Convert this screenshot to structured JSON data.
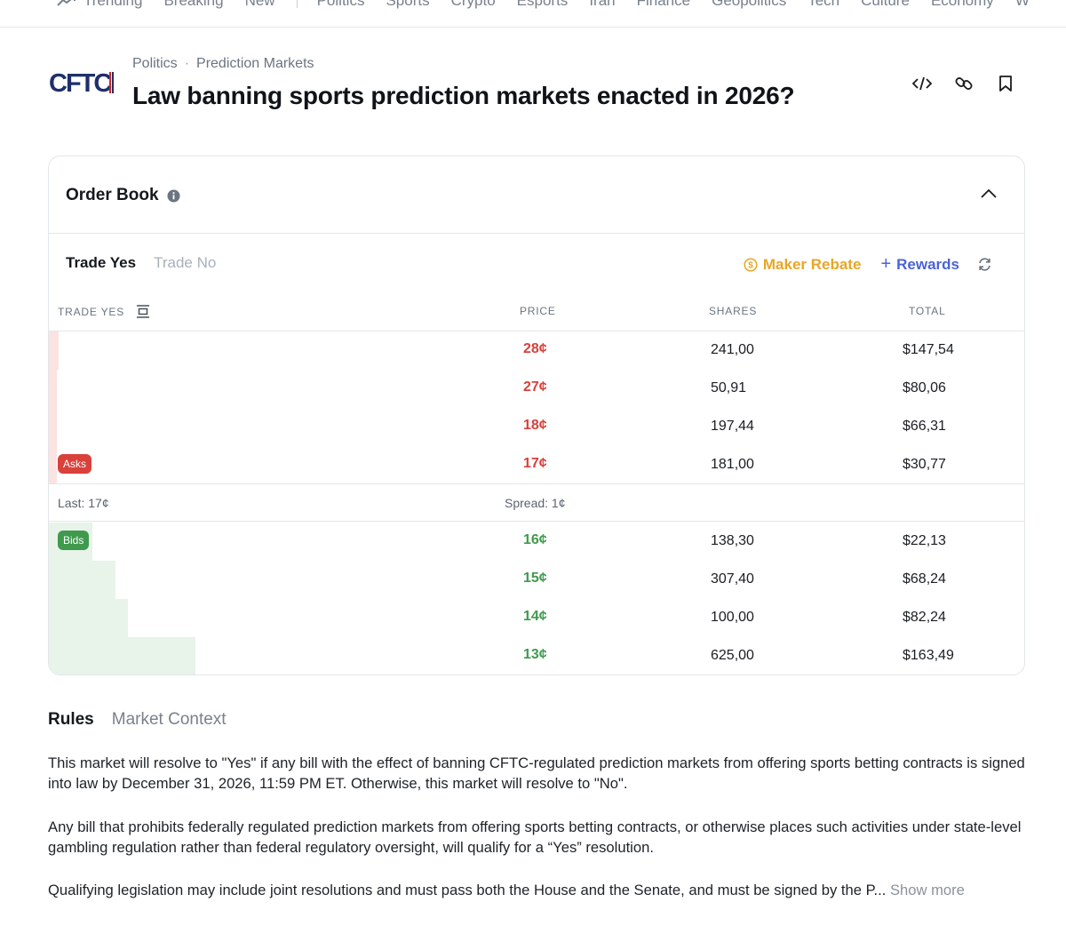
{
  "nav": {
    "items": [
      "Trending",
      "Breaking",
      "New",
      "Politics",
      "Sports",
      "Crypto",
      "Esports",
      "Iran",
      "Finance",
      "Geopolitics",
      "Tech",
      "Culture",
      "Economy",
      "W"
    ]
  },
  "header": {
    "logo_text": "CFTC",
    "breadcrumb": [
      "Politics",
      "Prediction Markets"
    ],
    "title": "Law banning sports prediction markets enacted in 2026?"
  },
  "order_book": {
    "title": "Order Book",
    "tabs": [
      "Trade Yes",
      "Trade No"
    ],
    "maker_rebate": "Maker Rebate",
    "rewards": "Rewards",
    "columns": [
      "TRADE YES",
      "PRICE",
      "SHARES",
      "TOTAL"
    ],
    "asks_label": "Asks",
    "bids_label": "Bids",
    "asks": [
      {
        "price": "28¢",
        "shares": "241,00",
        "total": "$147,54",
        "depth": 0.01
      },
      {
        "price": "27¢",
        "shares": "50,91",
        "total": "$80,06",
        "depth": 0.008
      },
      {
        "price": "18¢",
        "shares": "197,44",
        "total": "$66,31",
        "depth": 0.008
      },
      {
        "price": "17¢",
        "shares": "181,00",
        "total": "$30,77",
        "depth": 0.008
      }
    ],
    "last": "Last: 17¢",
    "spread": "Spread: 1¢",
    "bids": [
      {
        "price": "16¢",
        "shares": "138,30",
        "total": "$22,13",
        "depth": 0.045
      },
      {
        "price": "15¢",
        "shares": "307,40",
        "total": "$68,24",
        "depth": 0.068
      },
      {
        "price": "14¢",
        "shares": "100,00",
        "total": "$82,24",
        "depth": 0.081
      },
      {
        "price": "13¢",
        "shares": "625,00",
        "total": "$163,49",
        "depth": 0.15
      }
    ]
  },
  "rules": {
    "tabs": [
      "Rules",
      "Market Context"
    ],
    "p1": "This market will resolve to \"Yes\" if any bill with the effect of banning CFTC-regulated prediction markets from offering sports betting contracts is signed into law by December 31, 2026, 11:59 PM ET. Otherwise, this market will resolve to \"No\".",
    "p2": "Any bill that prohibits federally regulated prediction markets from offering sports betting contracts, or otherwise places such activities under state-level gambling regulation rather than federal regulatory oversight, will qualify for a “Yes” resolution.",
    "p3": "Qualifying legislation may include joint resolutions and must pass both the House and the Senate, and must be signed by the P...",
    "show_more": "Show more"
  },
  "colors": {
    "ask": "#d9413b",
    "bid": "#3f9a4e",
    "maker": "#e8a626",
    "rewards": "#4a63d8"
  }
}
